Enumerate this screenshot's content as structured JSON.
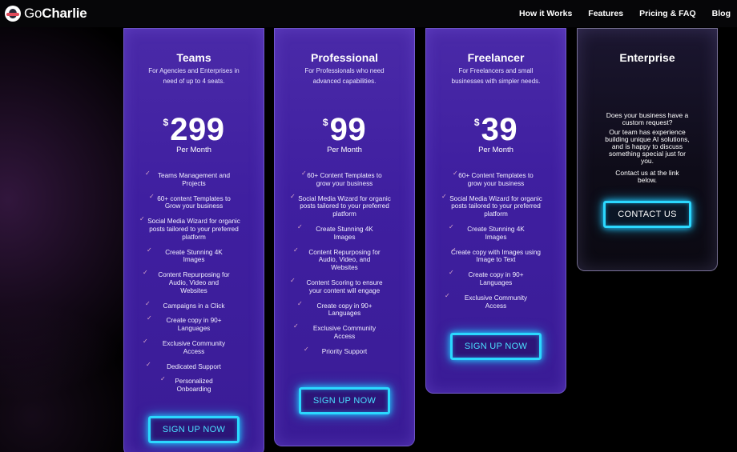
{
  "brand": {
    "name_prefix": "Go",
    "name_suffix": "Charlie"
  },
  "nav": [
    "How it Works",
    "Features",
    "Pricing & FAQ",
    "Blog"
  ],
  "colors": {
    "accent_neon": "#2bd8ff",
    "card_purple": "#3f1fa0",
    "check": "#d8a8c8"
  },
  "plans": {
    "teams": {
      "title": "Teams",
      "subtitle": "For Agencies and Enterprises in need of up to 4 seats.",
      "currency": "$",
      "price": "299",
      "period": "Per Month",
      "features": [
        "Teams Management and Projects",
        "60+ content Templates to Grow your business",
        "Social Media Wizard for organic posts tailored to your preferred platform",
        "Create Stunning 4K Images",
        "Content Repurposing for Audio, Video and Websites",
        "Campaigns in a Click",
        "Create copy in 90+ Languages",
        "Exclusive Community Access",
        "Dedicated Support",
        "Personalized Onboarding"
      ],
      "button": "SIGN UP NOW"
    },
    "professional": {
      "title": "Professional",
      "subtitle": "For Professionals who need advanced capabilities.",
      "currency": "$",
      "price": "99",
      "period": "Per Month",
      "features": [
        "60+ Content Templates to grow your business",
        "Social Media Wizard for organic posts tailored to your preferred platform",
        "Create Stunning 4K Images",
        "Content Repurposing for Audio, Video, and Websites",
        "Content Scoring to ensure your content will engage",
        "Create copy in 90+ Languages",
        "Exclusive Community Access",
        "Priority Support"
      ],
      "button": "SIGN UP NOW"
    },
    "freelancer": {
      "title": "Freelancer",
      "subtitle": "For Freelancers and small businesses with simpler needs.",
      "currency": "$",
      "price": "39",
      "period": "Per Month",
      "features": [
        "60+ Content Templates to grow your business",
        "Social Media Wizard for organic posts tailored to your preferred platform",
        "Create Stunning 4K Images",
        "Create copy with Images using Image to Text",
        "Create copy in 90+ Languages",
        "Exclusive Community Access"
      ],
      "button": "SIGN UP NOW"
    },
    "enterprise": {
      "title": "Enterprise",
      "question": "Does your business have a custom request?",
      "description": "Our team has experience building unique AI solutions, and is happy to discuss something special just for you.",
      "contact_note": "Contact us at the link below.",
      "button": "CONTACT US"
    }
  }
}
